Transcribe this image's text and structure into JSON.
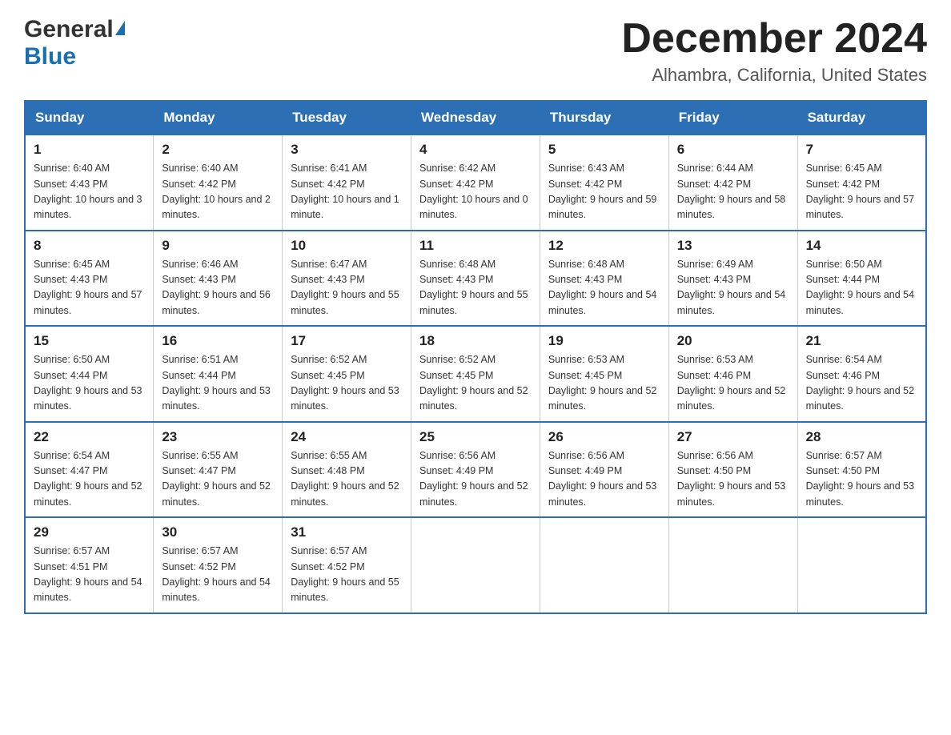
{
  "header": {
    "logo_general": "General",
    "logo_blue": "Blue",
    "month_title": "December 2024",
    "location": "Alhambra, California, United States"
  },
  "days_of_week": [
    "Sunday",
    "Monday",
    "Tuesday",
    "Wednesday",
    "Thursday",
    "Friday",
    "Saturday"
  ],
  "weeks": [
    [
      {
        "day": "1",
        "sunrise": "6:40 AM",
        "sunset": "4:43 PM",
        "daylight": "10 hours and 3 minutes."
      },
      {
        "day": "2",
        "sunrise": "6:40 AM",
        "sunset": "4:42 PM",
        "daylight": "10 hours and 2 minutes."
      },
      {
        "day": "3",
        "sunrise": "6:41 AM",
        "sunset": "4:42 PM",
        "daylight": "10 hours and 1 minute."
      },
      {
        "day": "4",
        "sunrise": "6:42 AM",
        "sunset": "4:42 PM",
        "daylight": "10 hours and 0 minutes."
      },
      {
        "day": "5",
        "sunrise": "6:43 AM",
        "sunset": "4:42 PM",
        "daylight": "9 hours and 59 minutes."
      },
      {
        "day": "6",
        "sunrise": "6:44 AM",
        "sunset": "4:42 PM",
        "daylight": "9 hours and 58 minutes."
      },
      {
        "day": "7",
        "sunrise": "6:45 AM",
        "sunset": "4:42 PM",
        "daylight": "9 hours and 57 minutes."
      }
    ],
    [
      {
        "day": "8",
        "sunrise": "6:45 AM",
        "sunset": "4:43 PM",
        "daylight": "9 hours and 57 minutes."
      },
      {
        "day": "9",
        "sunrise": "6:46 AM",
        "sunset": "4:43 PM",
        "daylight": "9 hours and 56 minutes."
      },
      {
        "day": "10",
        "sunrise": "6:47 AM",
        "sunset": "4:43 PM",
        "daylight": "9 hours and 55 minutes."
      },
      {
        "day": "11",
        "sunrise": "6:48 AM",
        "sunset": "4:43 PM",
        "daylight": "9 hours and 55 minutes."
      },
      {
        "day": "12",
        "sunrise": "6:48 AM",
        "sunset": "4:43 PM",
        "daylight": "9 hours and 54 minutes."
      },
      {
        "day": "13",
        "sunrise": "6:49 AM",
        "sunset": "4:43 PM",
        "daylight": "9 hours and 54 minutes."
      },
      {
        "day": "14",
        "sunrise": "6:50 AM",
        "sunset": "4:44 PM",
        "daylight": "9 hours and 54 minutes."
      }
    ],
    [
      {
        "day": "15",
        "sunrise": "6:50 AM",
        "sunset": "4:44 PM",
        "daylight": "9 hours and 53 minutes."
      },
      {
        "day": "16",
        "sunrise": "6:51 AM",
        "sunset": "4:44 PM",
        "daylight": "9 hours and 53 minutes."
      },
      {
        "day": "17",
        "sunrise": "6:52 AM",
        "sunset": "4:45 PM",
        "daylight": "9 hours and 53 minutes."
      },
      {
        "day": "18",
        "sunrise": "6:52 AM",
        "sunset": "4:45 PM",
        "daylight": "9 hours and 52 minutes."
      },
      {
        "day": "19",
        "sunrise": "6:53 AM",
        "sunset": "4:45 PM",
        "daylight": "9 hours and 52 minutes."
      },
      {
        "day": "20",
        "sunrise": "6:53 AM",
        "sunset": "4:46 PM",
        "daylight": "9 hours and 52 minutes."
      },
      {
        "day": "21",
        "sunrise": "6:54 AM",
        "sunset": "4:46 PM",
        "daylight": "9 hours and 52 minutes."
      }
    ],
    [
      {
        "day": "22",
        "sunrise": "6:54 AM",
        "sunset": "4:47 PM",
        "daylight": "9 hours and 52 minutes."
      },
      {
        "day": "23",
        "sunrise": "6:55 AM",
        "sunset": "4:47 PM",
        "daylight": "9 hours and 52 minutes."
      },
      {
        "day": "24",
        "sunrise": "6:55 AM",
        "sunset": "4:48 PM",
        "daylight": "9 hours and 52 minutes."
      },
      {
        "day": "25",
        "sunrise": "6:56 AM",
        "sunset": "4:49 PM",
        "daylight": "9 hours and 52 minutes."
      },
      {
        "day": "26",
        "sunrise": "6:56 AM",
        "sunset": "4:49 PM",
        "daylight": "9 hours and 53 minutes."
      },
      {
        "day": "27",
        "sunrise": "6:56 AM",
        "sunset": "4:50 PM",
        "daylight": "9 hours and 53 minutes."
      },
      {
        "day": "28",
        "sunrise": "6:57 AM",
        "sunset": "4:50 PM",
        "daylight": "9 hours and 53 minutes."
      }
    ],
    [
      {
        "day": "29",
        "sunrise": "6:57 AM",
        "sunset": "4:51 PM",
        "daylight": "9 hours and 54 minutes."
      },
      {
        "day": "30",
        "sunrise": "6:57 AM",
        "sunset": "4:52 PM",
        "daylight": "9 hours and 54 minutes."
      },
      {
        "day": "31",
        "sunrise": "6:57 AM",
        "sunset": "4:52 PM",
        "daylight": "9 hours and 55 minutes."
      },
      null,
      null,
      null,
      null
    ]
  ]
}
